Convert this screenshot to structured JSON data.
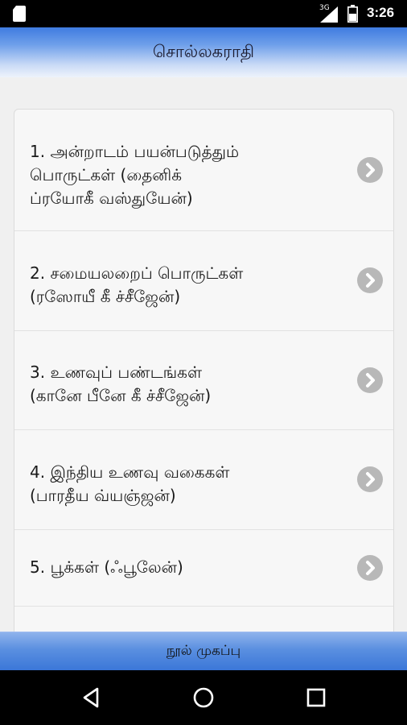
{
  "status_bar": {
    "time": "3:26",
    "network": "3G",
    "icons": [
      "sd-card-icon",
      "signal-icon",
      "battery-icon"
    ]
  },
  "header": {
    "title": "சொல்லகராதி"
  },
  "list": {
    "items": [
      {
        "label": "1. அன்றாடம் பயன்படுத்தும்\nபொருட்கள் (தைனிக்\nப்ரயோகீ வஸ்துயேன்)"
      },
      {
        "label": "2. சமையலறைப் பொருட்கள்\n(ரஸோயீ கீ ச்சீஜேன்)"
      },
      {
        "label": "3. உணவுப் பண்டங்கள்\n(கானே பீனே கீ ச்சீஜேன்)"
      },
      {
        "label": "4. இந்திய உணவு வகைகள்\n(பாரதீய வ்யஞ்ஜன்)"
      },
      {
        "label": "5. பூக்கள் (ஃபூலேன்)"
      }
    ]
  },
  "footer": {
    "button_label": "நூல் முகப்பு"
  },
  "nav": {
    "icons": [
      "back-icon",
      "home-icon",
      "recents-icon"
    ]
  },
  "colors": {
    "header_top": "#3f7be0",
    "button_blue": "#3b77d8",
    "chevron_gray": "#b8b8b8"
  }
}
